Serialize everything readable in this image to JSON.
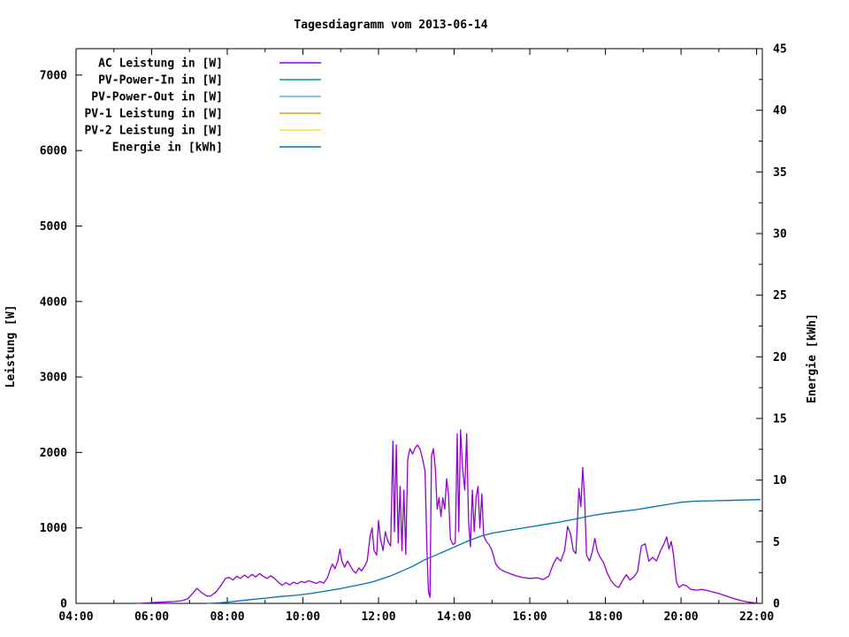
{
  "title": "Tagesdiagramm vom 2013-06-14",
  "chart_data": {
    "type": "line",
    "title": "Tagesdiagramm vom 2013-06-14",
    "grid": false,
    "legend_position": "top-left-inside",
    "x_axis": {
      "unit": "time",
      "range_hours": [
        4,
        22.15
      ],
      "major_tick_hours": [
        4,
        6,
        8,
        10,
        12,
        14,
        16,
        18,
        20,
        22
      ],
      "major_tick_labels": [
        "04:00",
        "06:00",
        "08:00",
        "10:00",
        "12:00",
        "14:00",
        "16:00",
        "18:00",
        "20:00",
        "22:00"
      ],
      "minor_tick_hours": [
        5,
        7,
        9,
        11,
        13,
        15,
        17,
        19,
        21
      ]
    },
    "y_axis_left": {
      "label": "Leistung [W]",
      "range": [
        0,
        7350
      ],
      "major_ticks": [
        0,
        1000,
        2000,
        3000,
        4000,
        5000,
        6000,
        7000
      ],
      "major_tick_labels": [
        "0",
        "1000",
        "2000",
        "3000",
        "4000",
        "5000",
        "6000",
        "7000"
      ]
    },
    "y_axis_right": {
      "label": "Energie [kWh]",
      "range": [
        0,
        45
      ],
      "major_ticks": [
        0,
        5,
        10,
        15,
        20,
        25,
        30,
        35,
        40,
        45
      ],
      "major_tick_labels": [
        "0",
        "5",
        "10",
        "15",
        "20",
        "25",
        "30",
        "35",
        "40",
        "45"
      ],
      "minor_ticks": [
        2.5,
        7.5,
        12.5,
        17.5,
        22.5,
        27.5,
        32.5,
        37.5,
        42.5
      ]
    },
    "legend": [
      {
        "label": "AC Leistung in [W]",
        "color": "#9400d3"
      },
      {
        "label": "PV-Power-In in [W]",
        "color": "#009e73"
      },
      {
        "label": "PV-Power-Out in [W]",
        "color": "#56b4e9"
      },
      {
        "label": "PV-1 Leistung in [W]",
        "color": "#e69f00"
      },
      {
        "label": "PV-2 Leistung in [W]",
        "color": "#f0e442"
      },
      {
        "label": "Energie in [kWh]",
        "color": "#0072b2"
      }
    ],
    "series": [
      {
        "name": "AC Leistung in [W]",
        "id": "ac-leistung",
        "color": "#9400d3",
        "axis": "left",
        "points": [
          [
            5.6,
            0
          ],
          [
            5.8,
            5
          ],
          [
            6.0,
            10
          ],
          [
            6.2,
            15
          ],
          [
            6.4,
            20
          ],
          [
            6.6,
            25
          ],
          [
            6.8,
            35
          ],
          [
            6.95,
            60
          ],
          [
            7.1,
            140
          ],
          [
            7.2,
            200
          ],
          [
            7.3,
            150
          ],
          [
            7.45,
            100
          ],
          [
            7.55,
            95
          ],
          [
            7.7,
            150
          ],
          [
            7.85,
            250
          ],
          [
            7.95,
            330
          ],
          [
            8.05,
            345
          ],
          [
            8.15,
            310
          ],
          [
            8.25,
            360
          ],
          [
            8.35,
            330
          ],
          [
            8.45,
            375
          ],
          [
            8.55,
            340
          ],
          [
            8.65,
            385
          ],
          [
            8.75,
            350
          ],
          [
            8.85,
            395
          ],
          [
            8.95,
            360
          ],
          [
            9.05,
            330
          ],
          [
            9.15,
            365
          ],
          [
            9.25,
            330
          ],
          [
            9.35,
            280
          ],
          [
            9.45,
            240
          ],
          [
            9.55,
            275
          ],
          [
            9.65,
            245
          ],
          [
            9.75,
            280
          ],
          [
            9.85,
            260
          ],
          [
            9.95,
            290
          ],
          [
            10.05,
            275
          ],
          [
            10.15,
            300
          ],
          [
            10.25,
            285
          ],
          [
            10.35,
            265
          ],
          [
            10.45,
            290
          ],
          [
            10.55,
            270
          ],
          [
            10.65,
            340
          ],
          [
            10.72,
            450
          ],
          [
            10.78,
            520
          ],
          [
            10.85,
            460
          ],
          [
            10.92,
            560
          ],
          [
            10.98,
            720
          ],
          [
            11.03,
            560
          ],
          [
            11.1,
            480
          ],
          [
            11.18,
            560
          ],
          [
            11.25,
            500
          ],
          [
            11.33,
            430
          ],
          [
            11.4,
            400
          ],
          [
            11.48,
            470
          ],
          [
            11.55,
            430
          ],
          [
            11.63,
            490
          ],
          [
            11.7,
            560
          ],
          [
            11.78,
            900
          ],
          [
            11.83,
            1000
          ],
          [
            11.88,
            700
          ],
          [
            11.95,
            640
          ],
          [
            12.0,
            1100
          ],
          [
            12.05,
            850
          ],
          [
            12.12,
            700
          ],
          [
            12.18,
            950
          ],
          [
            12.25,
            820
          ],
          [
            12.32,
            760
          ],
          [
            12.38,
            2150
          ],
          [
            12.42,
            950
          ],
          [
            12.47,
            2100
          ],
          [
            12.52,
            800
          ],
          [
            12.57,
            1550
          ],
          [
            12.62,
            700
          ],
          [
            12.67,
            1500
          ],
          [
            12.72,
            650
          ],
          [
            12.77,
            1900
          ],
          [
            12.83,
            2050
          ],
          [
            12.9,
            1980
          ],
          [
            12.97,
            2060
          ],
          [
            13.03,
            2100
          ],
          [
            13.1,
            2040
          ],
          [
            13.17,
            1900
          ],
          [
            13.23,
            1750
          ],
          [
            13.28,
            700
          ],
          [
            13.32,
            150
          ],
          [
            13.36,
            80
          ],
          [
            13.4,
            1950
          ],
          [
            13.45,
            2050
          ],
          [
            13.5,
            1800
          ],
          [
            13.55,
            1250
          ],
          [
            13.6,
            1400
          ],
          [
            13.65,
            1150
          ],
          [
            13.7,
            1400
          ],
          [
            13.75,
            1250
          ],
          [
            13.8,
            1650
          ],
          [
            13.85,
            1450
          ],
          [
            13.9,
            850
          ],
          [
            13.97,
            780
          ],
          [
            14.03,
            800
          ],
          [
            14.08,
            2250
          ],
          [
            14.12,
            950
          ],
          [
            14.17,
            2300
          ],
          [
            14.22,
            1800
          ],
          [
            14.28,
            1500
          ],
          [
            14.33,
            2250
          ],
          [
            14.38,
            1100
          ],
          [
            14.43,
            750
          ],
          [
            14.48,
            1500
          ],
          [
            14.53,
            950
          ],
          [
            14.58,
            1400
          ],
          [
            14.63,
            1550
          ],
          [
            14.68,
            1000
          ],
          [
            14.73,
            1450
          ],
          [
            14.78,
            900
          ],
          [
            14.85,
            820
          ],
          [
            14.92,
            780
          ],
          [
            15.0,
            700
          ],
          [
            15.1,
            520
          ],
          [
            15.2,
            460
          ],
          [
            15.3,
            430
          ],
          [
            15.45,
            400
          ],
          [
            15.6,
            370
          ],
          [
            15.8,
            345
          ],
          [
            16.0,
            330
          ],
          [
            16.2,
            340
          ],
          [
            16.35,
            315
          ],
          [
            16.5,
            360
          ],
          [
            16.62,
            520
          ],
          [
            16.72,
            610
          ],
          [
            16.82,
            560
          ],
          [
            16.92,
            700
          ],
          [
            17.0,
            1020
          ],
          [
            17.08,
            920
          ],
          [
            17.15,
            700
          ],
          [
            17.22,
            660
          ],
          [
            17.3,
            1520
          ],
          [
            17.35,
            1280
          ],
          [
            17.4,
            1800
          ],
          [
            17.45,
            1380
          ],
          [
            17.5,
            640
          ],
          [
            17.58,
            560
          ],
          [
            17.65,
            680
          ],
          [
            17.72,
            860
          ],
          [
            17.78,
            700
          ],
          [
            17.85,
            620
          ],
          [
            17.95,
            540
          ],
          [
            18.05,
            400
          ],
          [
            18.15,
            300
          ],
          [
            18.25,
            240
          ],
          [
            18.35,
            210
          ],
          [
            18.45,
            300
          ],
          [
            18.55,
            380
          ],
          [
            18.65,
            310
          ],
          [
            18.75,
            350
          ],
          [
            18.85,
            420
          ],
          [
            18.95,
            760
          ],
          [
            19.05,
            790
          ],
          [
            19.15,
            560
          ],
          [
            19.25,
            610
          ],
          [
            19.35,
            560
          ],
          [
            19.45,
            690
          ],
          [
            19.55,
            790
          ],
          [
            19.62,
            880
          ],
          [
            19.68,
            720
          ],
          [
            19.74,
            820
          ],
          [
            19.8,
            650
          ],
          [
            19.88,
            280
          ],
          [
            19.95,
            210
          ],
          [
            20.05,
            250
          ],
          [
            20.15,
            230
          ],
          [
            20.25,
            185
          ],
          [
            20.4,
            175
          ],
          [
            20.55,
            185
          ],
          [
            20.7,
            170
          ],
          [
            20.85,
            150
          ],
          [
            21.0,
            130
          ],
          [
            21.15,
            105
          ],
          [
            21.3,
            80
          ],
          [
            21.45,
            55
          ],
          [
            21.6,
            35
          ],
          [
            21.75,
            20
          ],
          [
            21.9,
            10
          ],
          [
            22.05,
            5
          ]
        ]
      },
      {
        "name": "PV-Power-In in [W]",
        "id": "pv-power-in",
        "color": "#009e73",
        "axis": "left",
        "points": []
      },
      {
        "name": "PV-Power-Out in [W]",
        "id": "pv-power-out",
        "color": "#56b4e9",
        "axis": "left",
        "points": []
      },
      {
        "name": "PV-1 Leistung in [W]",
        "id": "pv-1-leistung",
        "color": "#e69f00",
        "axis": "left",
        "points": []
      },
      {
        "name": "PV-2 Leistung in [W]",
        "id": "pv-2-leistung",
        "color": "#f0e442",
        "axis": "left",
        "points": []
      },
      {
        "name": "Energie in [kWh]",
        "id": "energie",
        "color": "#0072b2",
        "axis": "right",
        "points": [
          [
            7.45,
            0
          ],
          [
            7.8,
            0.05
          ],
          [
            8.0,
            0.1
          ],
          [
            8.3,
            0.2
          ],
          [
            8.6,
            0.3
          ],
          [
            9.0,
            0.42
          ],
          [
            9.4,
            0.55
          ],
          [
            9.8,
            0.65
          ],
          [
            10.2,
            0.8
          ],
          [
            10.6,
            1.0
          ],
          [
            11.0,
            1.2
          ],
          [
            11.4,
            1.45
          ],
          [
            11.8,
            1.7
          ],
          [
            12.0,
            1.9
          ],
          [
            12.3,
            2.2
          ],
          [
            12.6,
            2.6
          ],
          [
            12.9,
            3.0
          ],
          [
            13.2,
            3.5
          ],
          [
            13.5,
            3.9
          ],
          [
            13.8,
            4.3
          ],
          [
            14.1,
            4.7
          ],
          [
            14.4,
            5.1
          ],
          [
            14.7,
            5.45
          ],
          [
            15.0,
            5.7
          ],
          [
            15.3,
            5.85
          ],
          [
            15.6,
            6.0
          ],
          [
            16.0,
            6.2
          ],
          [
            16.4,
            6.4
          ],
          [
            16.8,
            6.6
          ],
          [
            17.2,
            6.85
          ],
          [
            17.6,
            7.1
          ],
          [
            18.0,
            7.3
          ],
          [
            18.4,
            7.45
          ],
          [
            18.8,
            7.6
          ],
          [
            19.2,
            7.8
          ],
          [
            19.6,
            8.0
          ],
          [
            20.0,
            8.2
          ],
          [
            20.4,
            8.3
          ],
          [
            20.8,
            8.32
          ],
          [
            21.2,
            8.35
          ],
          [
            21.6,
            8.38
          ],
          [
            22.1,
            8.42
          ]
        ]
      }
    ]
  },
  "colors": {
    "background": "#ffffff",
    "axis": "#000000",
    "text": "#000000"
  }
}
